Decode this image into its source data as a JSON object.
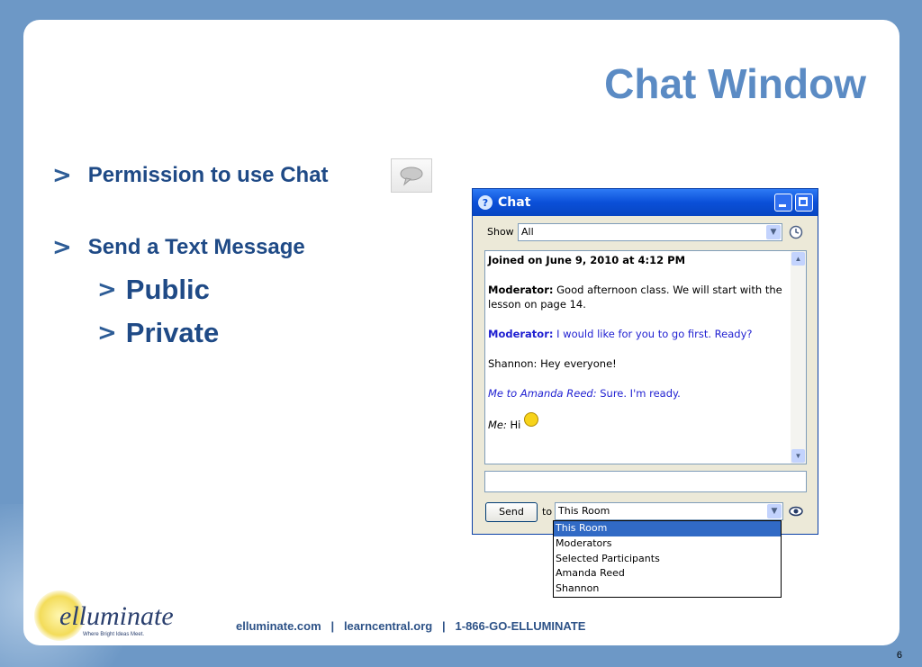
{
  "slide": {
    "title": "Chat Window",
    "page_number": "6",
    "bullets": [
      {
        "label": "Permission to use Chat"
      },
      {
        "label": "Send a Text Message",
        "sub": [
          "Public",
          "Private"
        ]
      }
    ]
  },
  "chat_window": {
    "title": "Chat",
    "show_label": "Show",
    "show_value": "All",
    "log": {
      "joined": "Joined on June 9, 2010 at 4:12 PM",
      "msg1_sender": "Moderator:",
      "msg1_text": " Good afternoon class.  We will start with the lesson on page 14.",
      "msg2_sender": "Moderator:",
      "msg2_text": " I would like for you to go first.  Ready?",
      "msg3": "Shannon: Hey everyone!",
      "msg4_sender": "Me to Amanda Reed:",
      "msg4_text": " Sure. I'm ready.",
      "msg5_sender": "Me:",
      "msg5_text": " Hi"
    },
    "send_label": "Send",
    "to_label": "to",
    "to_value": "This Room",
    "dropdown_options": [
      "This Room",
      "Moderators",
      "Selected Participants",
      "Amanda Reed",
      "Shannon"
    ]
  },
  "footer": {
    "logo": "elluminate",
    "tagline": "Where Bright Ideas Meet.",
    "links": "elluminate.com   |   learncentral.org   |   1-866-GO-ELLUMINATE"
  },
  "colors": {
    "background": "#6d98c6",
    "title": "#5b8bc4",
    "bullet_text": "#1f4a86",
    "xp_titlebar": "#0a4fd8",
    "moderator_blue": "#1f1fd1"
  }
}
